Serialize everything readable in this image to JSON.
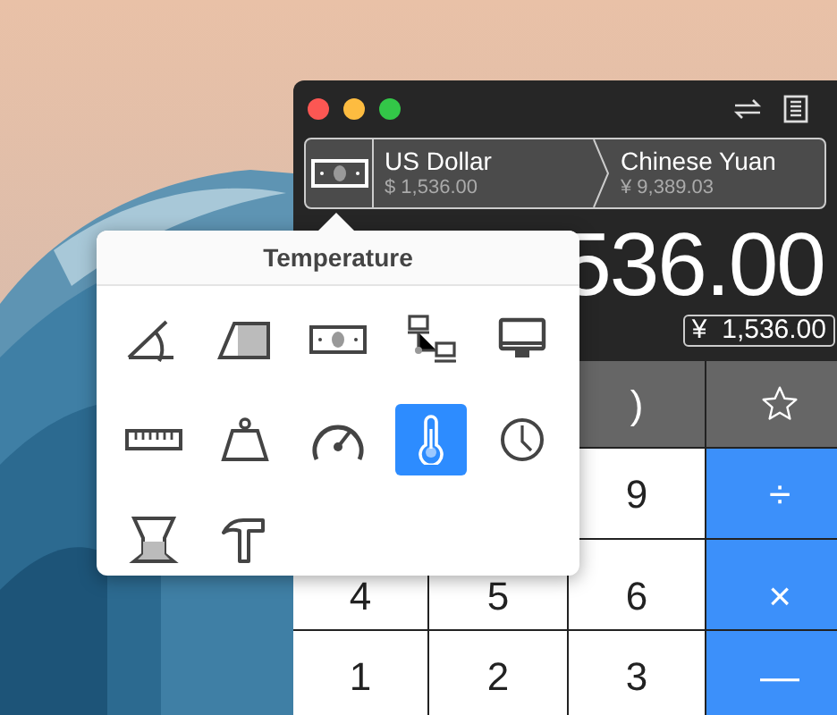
{
  "window": {
    "traffic_lights": [
      {
        "color": "#fc5753"
      },
      {
        "color": "#fdbc40"
      },
      {
        "color": "#33c748"
      }
    ],
    "currency_from": {
      "name": "US Dollar",
      "amount": "$ 1,536.00"
    },
    "currency_to": {
      "name": "Chinese Yuan",
      "amount": "¥ 9,389.03"
    },
    "display": {
      "value": "536.00",
      "secondary": "¥  1,536.00"
    },
    "keypad": [
      [
        {
          "kind": "blank"
        },
        {
          "kind": "blank"
        },
        {
          "kind": "function",
          "label": ")"
        },
        {
          "kind": "favorite"
        }
      ],
      [
        {
          "kind": "blank"
        },
        {
          "kind": "blank"
        },
        {
          "kind": "digit",
          "label": "9"
        },
        {
          "kind": "operator",
          "label": "÷"
        }
      ],
      [
        {
          "kind": "digit",
          "label": "4"
        },
        {
          "kind": "digit",
          "label": "5"
        },
        {
          "kind": "digit",
          "label": "6"
        },
        {
          "kind": "operator",
          "label": "×"
        }
      ],
      [
        {
          "kind": "digit",
          "label": "1"
        },
        {
          "kind": "digit",
          "label": "2"
        },
        {
          "kind": "digit",
          "label": "3"
        },
        {
          "kind": "operator",
          "label": "—"
        }
      ]
    ]
  },
  "popover": {
    "title": "Temperature",
    "units": [
      {
        "kind": "angle",
        "selected": false
      },
      {
        "kind": "area",
        "selected": false
      },
      {
        "kind": "currency",
        "selected": false
      },
      {
        "kind": "network",
        "selected": false
      },
      {
        "kind": "display",
        "selected": false
      },
      {
        "kind": "length",
        "selected": false
      },
      {
        "kind": "weight",
        "selected": false
      },
      {
        "kind": "speed",
        "selected": false
      },
      {
        "kind": "temperature",
        "selected": true
      },
      {
        "kind": "time",
        "selected": false
      },
      {
        "kind": "volume",
        "selected": false
      },
      {
        "kind": "hammer",
        "selected": false
      }
    ]
  }
}
